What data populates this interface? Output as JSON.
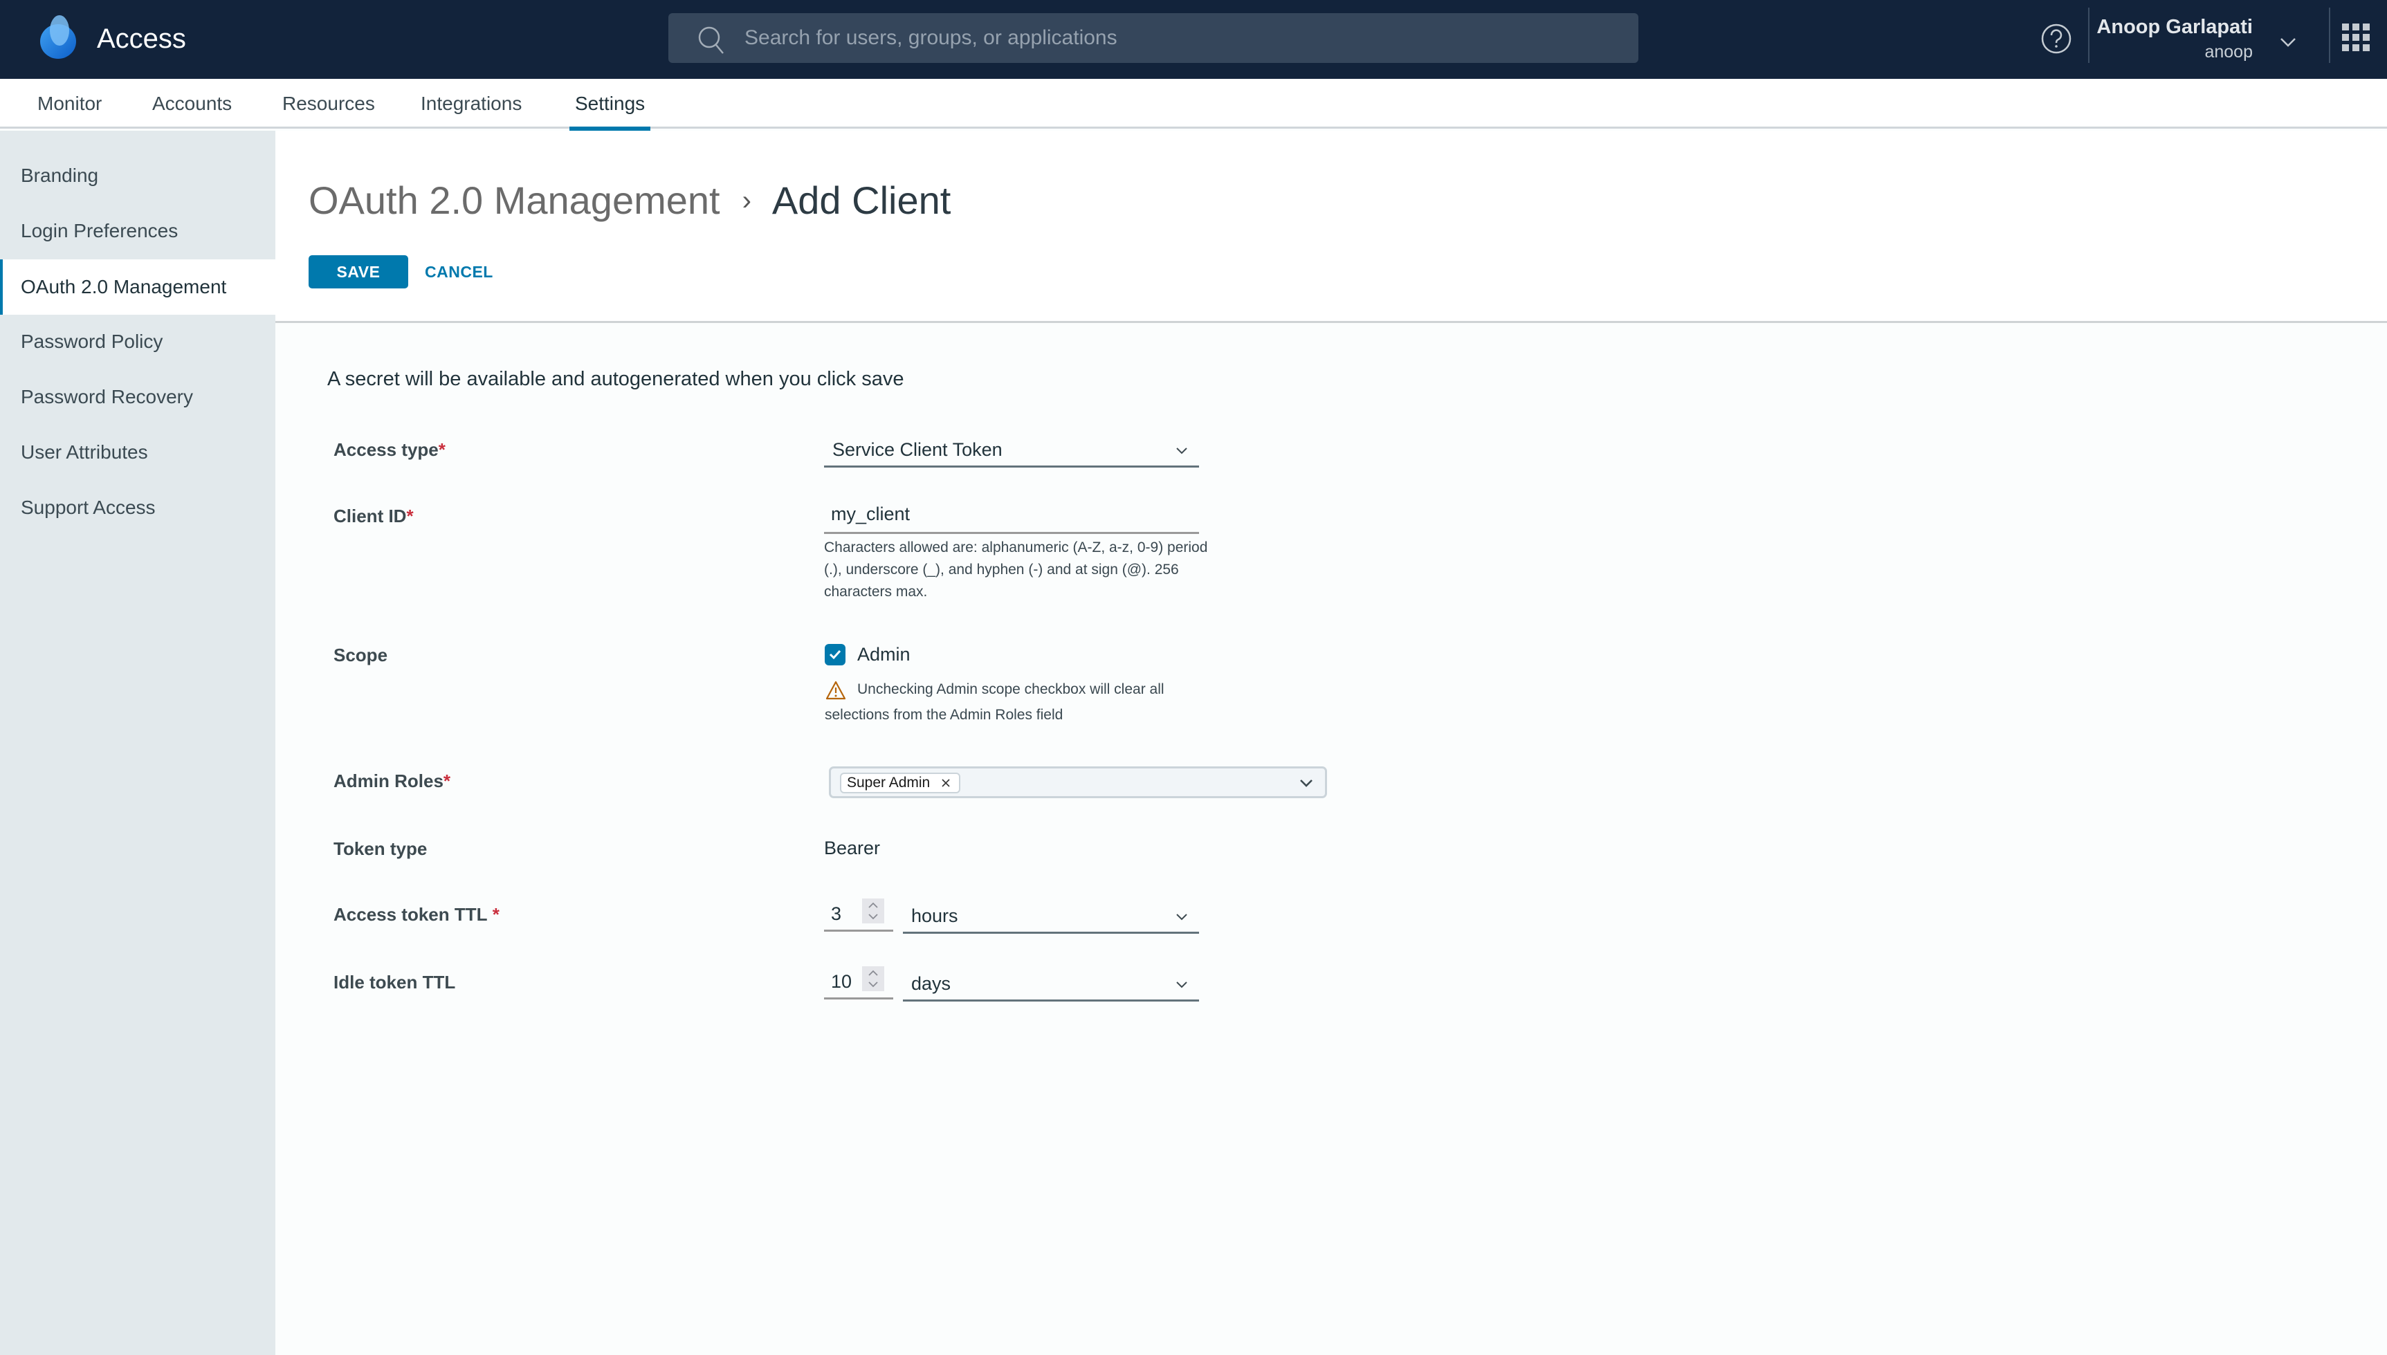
{
  "header": {
    "app_title": "Access",
    "search_placeholder": "Search for users, groups, or applications",
    "user_name": "Anoop Garlapati",
    "user_login": "anoop",
    "icons": [
      "logo-icon",
      "search-icon",
      "help-icon",
      "chevron-down-icon",
      "apps-grid-icon"
    ]
  },
  "topnav": {
    "tabs": [
      {
        "label": "Monitor",
        "active": false
      },
      {
        "label": "Accounts",
        "active": false
      },
      {
        "label": "Resources",
        "active": false
      },
      {
        "label": "Integrations",
        "active": false
      },
      {
        "label": "Settings",
        "active": true
      }
    ]
  },
  "sidebar": {
    "items": [
      {
        "label": "Branding",
        "active": false
      },
      {
        "label": "Login Preferences",
        "active": false
      },
      {
        "label": "OAuth 2.0 Management",
        "active": true
      },
      {
        "label": "Password Policy",
        "active": false
      },
      {
        "label": "Password Recovery",
        "active": false
      },
      {
        "label": "User Attributes",
        "active": false
      },
      {
        "label": "Support Access",
        "active": false
      }
    ]
  },
  "page": {
    "breadcrumb_parent": "OAuth 2.0 Management",
    "breadcrumb_separator": "›",
    "breadcrumb_current": "Add Client",
    "save_label": "SAVE",
    "cancel_label": "CANCEL"
  },
  "form": {
    "info_text": "A secret will be available and autogenerated when you click save",
    "required_marker": "*",
    "access_type": {
      "label": "Access type",
      "required": true,
      "value": "Service Client Token"
    },
    "client_id": {
      "label": "Client ID",
      "required": true,
      "value": "my_client",
      "helper": "Characters allowed are: alphanumeric (A-Z, a-z, 0-9) period (.), underscore (_), and hyphen (-) and at sign (@). 256 characters max."
    },
    "scope": {
      "label": "Scope",
      "option_label": "Admin",
      "checked": true,
      "warning": "Unchecking Admin scope checkbox will clear all selections from the Admin Roles field"
    },
    "admin_roles": {
      "label": "Admin Roles",
      "required": true,
      "selected": [
        "Super Admin"
      ]
    },
    "token_type": {
      "label": "Token type",
      "value": "Bearer"
    },
    "access_token_ttl": {
      "label": "Access token TTL",
      "required": true,
      "value": "3",
      "unit": "hours"
    },
    "idle_token_ttl": {
      "label": "Idle token TTL",
      "value": "10",
      "unit": "days"
    }
  },
  "colors": {
    "header_bg": "#12233b",
    "accent": "#0079ad",
    "sidebar_bg": "#e2e9ec",
    "required": "#c92f3d",
    "warning": "#b5650c"
  }
}
